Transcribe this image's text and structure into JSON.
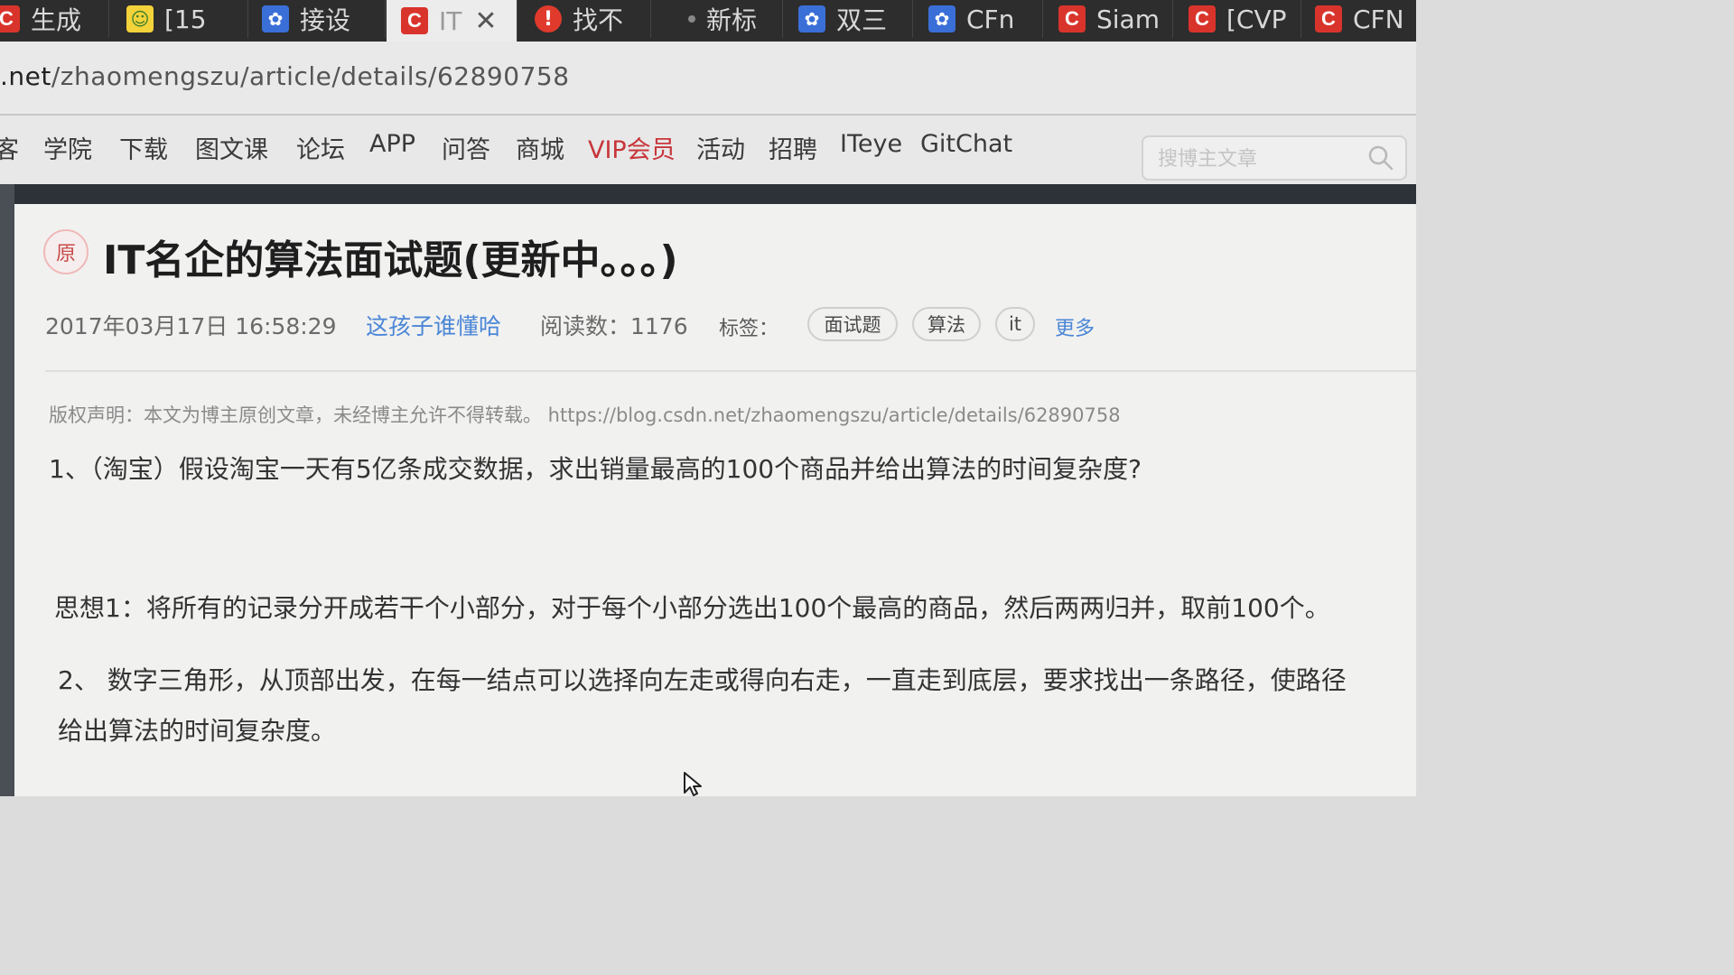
{
  "tabs": [
    {
      "label": "生成",
      "icon": "csdn-icon",
      "active": false
    },
    {
      "label": "[15",
      "icon": "smile-icon",
      "active": false
    },
    {
      "label": "接设",
      "icon": "baidu-paw-icon",
      "active": false
    },
    {
      "label": "IT",
      "icon": "csdn-icon",
      "active": true
    },
    {
      "label": "找不",
      "icon": "warning-icon",
      "active": false
    },
    {
      "label": "新标",
      "icon": "dot-icon",
      "active": false
    },
    {
      "label": "双三",
      "icon": "baidu-paw-icon",
      "active": false
    },
    {
      "label": "CFn",
      "icon": "baidu-paw-icon",
      "active": false
    },
    {
      "label": "Siam",
      "icon": "csdn-icon",
      "active": false
    },
    {
      "label": "[CVP",
      "icon": "csdn-icon",
      "active": false
    },
    {
      "label": "CFN",
      "icon": "csdn-icon",
      "active": false
    }
  ],
  "address": {
    "host": ".net",
    "path": "/zhaomengszu/article/details/62890758"
  },
  "nav": {
    "items": [
      "客",
      "学院",
      "下载",
      "图文课",
      "论坛",
      "APP",
      "问答",
      "商城",
      "VIP会员",
      "活动",
      "招聘",
      "ITeye",
      "GitChat"
    ],
    "search_placeholder": "搜博主文章"
  },
  "article": {
    "badge": "原",
    "title": "IT名企的算法面试题(更新中。。。)",
    "date": "2017年03月17日 16:58:29",
    "author": "这孩子谁懂哈",
    "reads": "阅读数：1176",
    "tags_label": "标签：",
    "tags": [
      "面试题",
      "算法",
      "it"
    ],
    "more": "更多",
    "copyright": "版权声明：本文为博主原创文章，未经博主允许不得转载。 https://blog.csdn.net/zhaomengszu/article/details/62890758",
    "p1": "1、（淘宝）假设淘宝一天有5亿条成交数据，求出销量最高的100个商品并给出算法的时间复杂度?",
    "p2": "思想1：将所有的记录分开成若干个小部分，对于每个小部分选出100个最高的商品，然后两两归并，取前100个。",
    "p3": "2、 数字三角形，从顶部出发，在每一结点可以选择向左走或得向右走，一直走到底层，要求找出一条路径，使路径",
    "p4": "给出算法的时间复杂度。"
  },
  "colors": {
    "csdn_red": "#d9342b",
    "link_blue": "#4b86d6",
    "vip_red": "#c8353a"
  }
}
